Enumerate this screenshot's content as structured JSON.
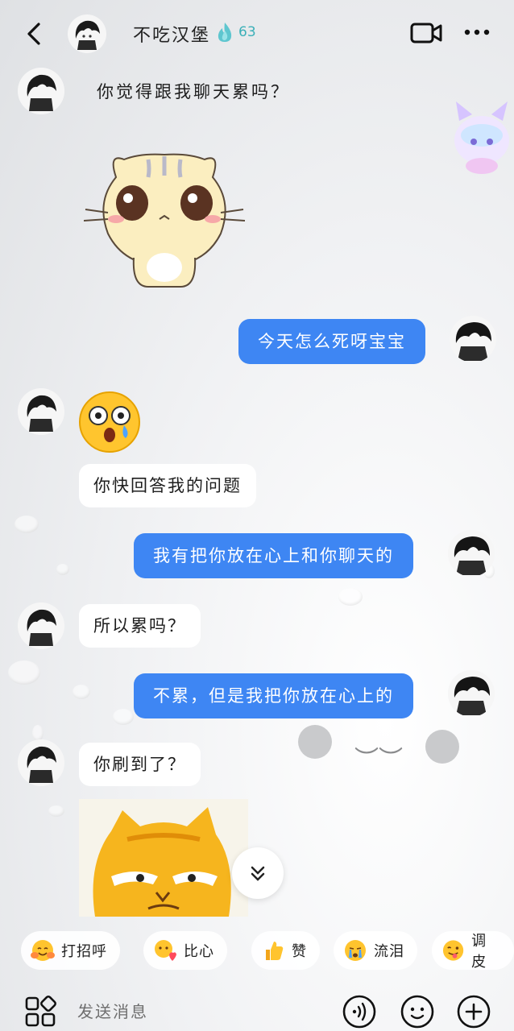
{
  "header": {
    "contact_name": "不吃汉堡",
    "intimacy_level": "63"
  },
  "messages": [
    {
      "text": "你觉得跟我聊天累吗？"
    },
    {
      "text": "今天怎么死呀宝宝"
    },
    {
      "text": "你快回答我的问题"
    },
    {
      "text": "我有把你放在心上和你聊天的"
    },
    {
      "text": "所以累吗？"
    },
    {
      "text": "不累，但是我把你放在心上的"
    },
    {
      "text": "你刷到了？"
    }
  ],
  "quick_replies": [
    {
      "label": "打招呼",
      "icon": "hug-emoji-icon"
    },
    {
      "label": "比心",
      "icon": "heart-hands-emoji-icon"
    },
    {
      "label": "赞",
      "icon": "thumbs-up-icon"
    },
    {
      "label": "流泪",
      "icon": "crying-emoji-icon"
    },
    {
      "label": "调皮",
      "icon": "wink-tongue-emoji-icon"
    }
  ],
  "input": {
    "placeholder": "发送消息"
  },
  "colors": {
    "outgoing_bubble": "#3e86f3",
    "incoming_bubble": "#ffffff",
    "level_accent": "#3bb0b8"
  }
}
